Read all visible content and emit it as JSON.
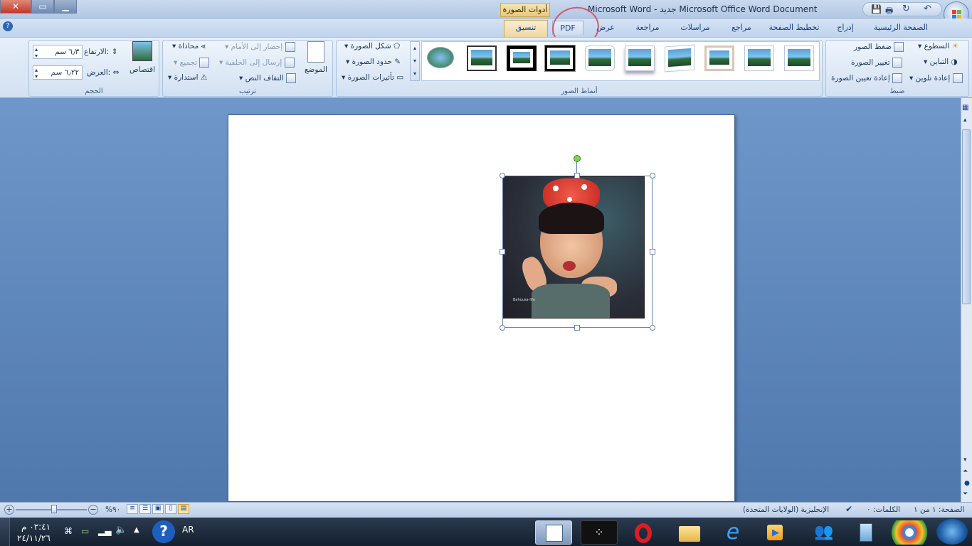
{
  "window": {
    "title": "Microsoft Word - جديد Microsoft Office Word Document",
    "context_label": "أدوات الصورة",
    "close_label": "x"
  },
  "tabs": [
    "الصفحة الرئيسية",
    "إدراج",
    "تخطيط الصفحة",
    "مراجع",
    "مراسلات",
    "مراجعة",
    "عرض",
    "PDF",
    "تنسيق"
  ],
  "ribbon": {
    "adjust": {
      "label": "ضبط",
      "brightness": "السطوع",
      "contrast": "التباين",
      "recolor": "إعادة تلوين",
      "compress": "ضغط الصور",
      "change": "تغيير الصورة",
      "reset": "إعادة تعيين الصورة"
    },
    "styles": {
      "label": "أنماط الصور",
      "shape": "شكل الصورة",
      "border": "حدود الصورة",
      "effects": "تأثيرات الصورة"
    },
    "arrange": {
      "label": "ترتيب",
      "front": "إحضار إلى الأمام",
      "back": "إرسال إلى الخلفية",
      "wrap": "التفاف النص",
      "align": "محاذاة",
      "group": "تجميع",
      "rotate": "استدارة",
      "position": "الموضع"
    },
    "size": {
      "label": "الحجم",
      "height_label": "الارتفاع:",
      "height_value": "٦٫٣ سم",
      "width_label": "العرض:",
      "width_value": "٦٫٢٢ سم",
      "crop": "اقتصاص"
    }
  },
  "status": {
    "page": "الصفحة: ١ من ١",
    "words": "الكلمات: ٠",
    "language": "الإنجليزية (الولايات المتحدة)",
    "zoom": "%٩٠"
  },
  "taskbar": {
    "time": "٠٢:٤١ م",
    "date": "٢٤/١١/٢٦",
    "lang": "AR"
  },
  "image": {
    "watermark": "Bahousa-life"
  }
}
